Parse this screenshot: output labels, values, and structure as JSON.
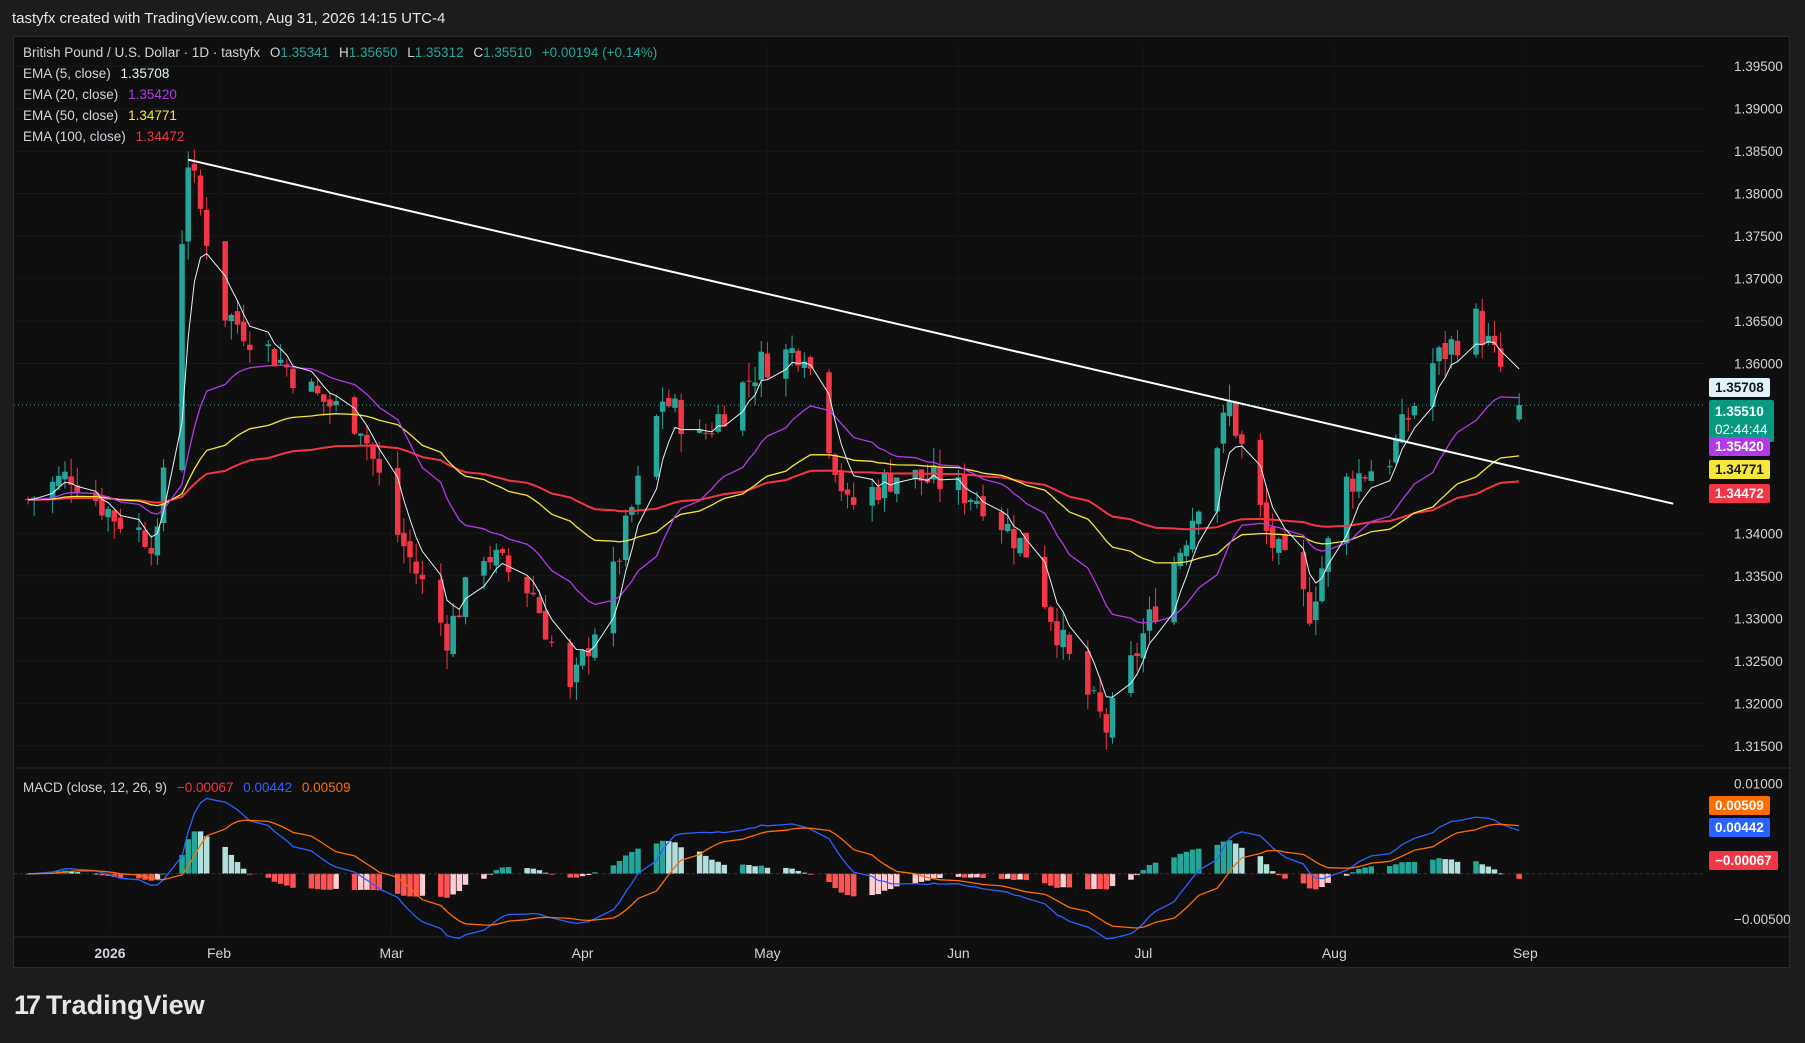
{
  "header": {
    "text": "tastyfx created with TradingView.com, Aug 31, 2026 14:15 UTC-4"
  },
  "legend": {
    "symbol": "British Pound / U.S. Dollar · 1D · tastyfx",
    "o_label": "O",
    "o": "1.35341",
    "h_label": "H",
    "h": "1.35650",
    "l_label": "L",
    "l": "1.35312",
    "c_label": "C",
    "c": "1.35510",
    "change": "+0.00194 (+0.14%)",
    "ema5": {
      "label": "EMA (5, close)",
      "value": "1.35708",
      "color": "#e0f2f7"
    },
    "ema20": {
      "label": "EMA (20, close)",
      "value": "1.35420",
      "color": "#b23ae8"
    },
    "ema50": {
      "label": "EMA (50, close)",
      "value": "1.34771",
      "color": "#f5e73c"
    },
    "ema100": {
      "label": "EMA (100, close)",
      "value": "1.34472",
      "color": "#f23645"
    },
    "macd": {
      "label": "MACD (close, 12, 26, 9)",
      "hist": "−0.00067",
      "macd": "0.00442",
      "signal": "0.00509"
    }
  },
  "price_tags": {
    "ema5": "1.35708",
    "close": "1.35510",
    "countdown": "02:44:44",
    "ema20": "1.35420",
    "ema50": "1.34771",
    "ema100": "1.34472",
    "signal": "0.00509",
    "macd": "0.00442",
    "hist": "−0.00067"
  },
  "colors": {
    "up": "#26a69a",
    "down": "#f23645",
    "ema5": "#e0f2f7",
    "ema20": "#b23ae8",
    "ema50": "#f5e73c",
    "ema100": "#f23645",
    "macd": "#2962ff",
    "signal": "#ff6d00",
    "hist_up_strong": "#26a69a",
    "hist_up_weak": "#b2dfdb",
    "hist_down_strong": "#ff5252",
    "hist_down_weak": "#ffcdd2"
  },
  "footer": {
    "logo_mark": "17",
    "logo_text": "TradingView"
  },
  "chart_data": {
    "type": "candlestick",
    "price_axis": {
      "ticks": [
        "1.39500",
        "1.39000",
        "1.38500",
        "1.38000",
        "1.37500",
        "1.37000",
        "1.36500",
        "1.36000",
        "1.34000",
        "1.33500",
        "1.33000",
        "1.32500",
        "1.32000",
        "1.31500"
      ],
      "ylim": [
        1.3125,
        1.3975
      ]
    },
    "macd_axis": {
      "ticks": [
        "0.01000",
        "−0.00500"
      ],
      "ylim": [
        -0.0068,
        0.0115
      ]
    },
    "time_axis": [
      "2026",
      "Feb",
      "Mar",
      "Apr",
      "May",
      "Jun",
      "Jul",
      "Aug",
      "Sep"
    ],
    "close_keypoints": [
      [
        "2026-01-01",
        1.344
      ],
      [
        "2026-01-08",
        1.347
      ],
      [
        "2026-01-15",
        1.342
      ],
      [
        "2026-01-22",
        1.339
      ],
      [
        "2026-01-27",
        1.384
      ],
      [
        "2026-02-02",
        1.366
      ],
      [
        "2026-02-10",
        1.361
      ],
      [
        "2026-02-17",
        1.356
      ],
      [
        "2026-02-24",
        1.353
      ],
      [
        "2026-03-02",
        1.34
      ],
      [
        "2026-03-10",
        1.328
      ],
      [
        "2026-03-16",
        1.338
      ],
      [
        "2026-03-24",
        1.333
      ],
      [
        "2026-03-30",
        1.321
      ],
      [
        "2026-04-06",
        1.335
      ],
      [
        "2026-04-14",
        1.356
      ],
      [
        "2026-04-20",
        1.351
      ],
      [
        "2026-04-30",
        1.36
      ],
      [
        "2026-05-07",
        1.362
      ],
      [
        "2026-05-14",
        1.343
      ],
      [
        "2026-05-22",
        1.347
      ],
      [
        "2026-05-29",
        1.346
      ],
      [
        "2026-06-05",
        1.344
      ],
      [
        "2026-06-12",
        1.338
      ],
      [
        "2026-06-19",
        1.325
      ],
      [
        "2026-06-25",
        1.317
      ],
      [
        "2026-07-01",
        1.328
      ],
      [
        "2026-07-08",
        1.34
      ],
      [
        "2026-07-15",
        1.355
      ],
      [
        "2026-07-21",
        1.34
      ],
      [
        "2026-07-28",
        1.331
      ],
      [
        "2026-08-03",
        1.346
      ],
      [
        "2026-08-10",
        1.349
      ],
      [
        "2026-08-17",
        1.36
      ],
      [
        "2026-08-24",
        1.365
      ],
      [
        "2026-08-31",
        1.3551
      ]
    ],
    "trendline": {
      "from": [
        "2026-01-27",
        1.384
      ],
      "to": [
        "2026-09-25",
        1.3435
      ]
    }
  }
}
